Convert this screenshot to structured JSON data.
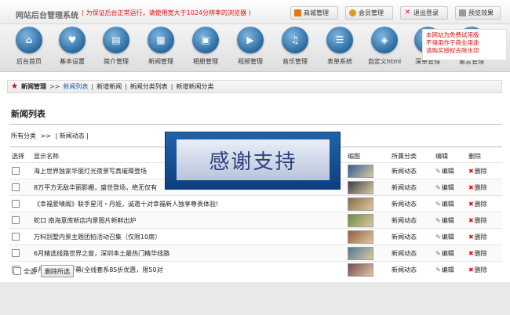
{
  "header": {
    "site_title": "网站后台管理系统",
    "notice": "( 为保证后台正常运行，请使用宽大于1024分辨率的浏览器 )",
    "buttons": [
      {
        "label": "商城管理",
        "icon": "store-icon"
      },
      {
        "label": "会员管理",
        "icon": "member-icon"
      },
      {
        "label": "退出登录",
        "icon": "logout-icon"
      },
      {
        "label": "预览效果",
        "icon": "preview-icon"
      }
    ]
  },
  "nav": {
    "items": [
      {
        "label": "后台首页",
        "icon": "home-icon"
      },
      {
        "label": "基本设置",
        "icon": "heart-icon"
      },
      {
        "label": "简介管理",
        "icon": "document-icon"
      },
      {
        "label": "新闻管理",
        "icon": "news-icon"
      },
      {
        "label": "相册管理",
        "icon": "album-icon"
      },
      {
        "label": "视频管理",
        "icon": "video-icon"
      },
      {
        "label": "音乐管理",
        "icon": "music-icon"
      },
      {
        "label": "表单系统",
        "icon": "form-icon"
      },
      {
        "label": "自定义html",
        "icon": "html-icon"
      },
      {
        "label": "深单管理",
        "icon": "order-icon"
      },
      {
        "label": "留言管理",
        "icon": "message-icon"
      }
    ],
    "promo": "本网站为免费试用版\n不得用作于商业用途\n请购买授权去除水印"
  },
  "breadcrumb": {
    "section": "新闻管理",
    "separator": ">>",
    "current": "新闻列表",
    "links": [
      "新增新闻",
      "新闻分类列表",
      "新增新闻分类"
    ]
  },
  "page": {
    "title": "新闻列表",
    "category_line": {
      "all": "所有分类",
      "sep": ">>",
      "current": "新闻动态"
    }
  },
  "table": {
    "headers": [
      "选择",
      "显示名称",
      "缩图",
      "所属分类",
      "编辑",
      "删除"
    ],
    "edit_label": "编辑",
    "delete_label": "删除",
    "rows": [
      {
        "title": "海上世界独家华丽灯光夜景写真璀璨登场",
        "category": "新闻动态",
        "thumb": "#2e5f9b"
      },
      {
        "title": "8万平方无敌华丽影棚，盛世登场，绝无仅有",
        "category": "新闻动态",
        "thumb": "#3b3e4a"
      },
      {
        "title": "《幸福爱晴阁》联手星河・丹娅，诚邀十对幸福新人独享尊贵体验!",
        "category": "新闻动态",
        "thumb": "#8a6d4a"
      },
      {
        "title": "蛇口 南海意库新店内景图片新鲜出炉",
        "category": "新闻动态",
        "thumb": "#6d8a3e"
      },
      {
        "title": "万科别墅内景主题团拍活动召集（仅限10席）",
        "category": "新闻动态",
        "thumb": "#9a5a3a"
      },
      {
        "title": "6月精选线路世界之窗，深圳本土最热门精华线路",
        "category": "新闻动态",
        "thumb": "#4d7a9a"
      },
      {
        "title": "5月广州盛大开幕(全线套系85折优惠，限50对",
        "category": "新闻动态",
        "thumb": "#7a4a5a"
      }
    ]
  },
  "footer_actions": {
    "select_all": "全选",
    "delete_selected": "删除所选"
  },
  "overlay": {
    "text": "感谢支持"
  }
}
